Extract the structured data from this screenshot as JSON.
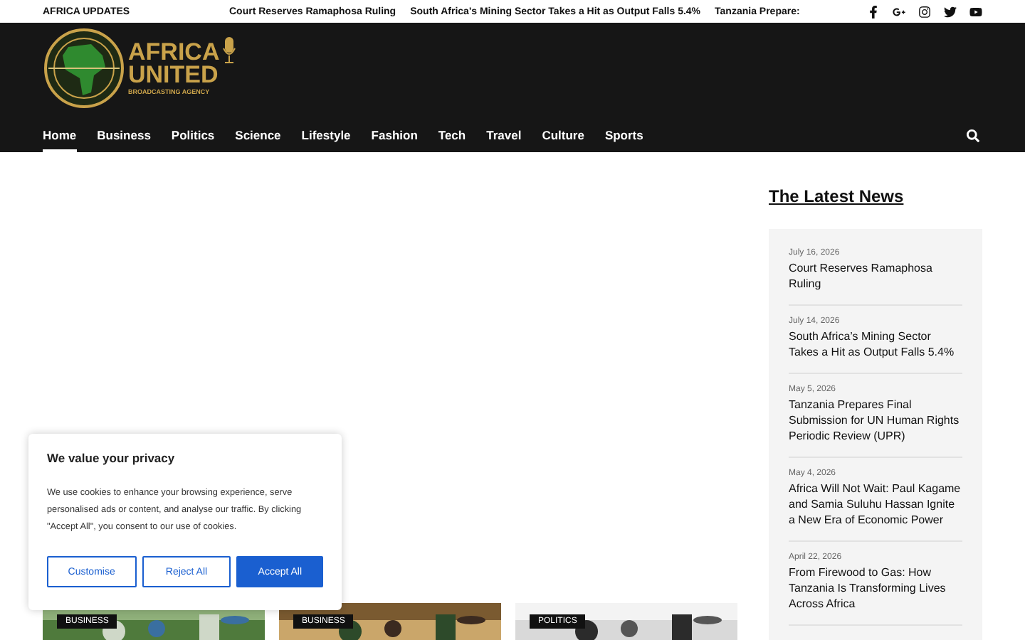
{
  "top_bar": {
    "label": "AFRICA UPDATES",
    "ticker": [
      "Court Reserves Ramaphosa Ruling",
      "South Africa's Mining Sector Takes a Hit as Output Falls 5.4%",
      "Tanzania Prepare:"
    ]
  },
  "logo": {
    "line1": "AFRICA",
    "line2": "UNITED",
    "tagline": "BROADCASTING AGENCY"
  },
  "nav": [
    {
      "label": "Home",
      "selected": true
    },
    {
      "label": "Business",
      "selected": false
    },
    {
      "label": "Politics",
      "selected": false
    },
    {
      "label": "Science",
      "selected": false
    },
    {
      "label": "Lifestyle",
      "selected": false
    },
    {
      "label": "Fashion",
      "selected": false
    },
    {
      "label": "Tech",
      "selected": false
    },
    {
      "label": "Travel",
      "selected": false
    },
    {
      "label": "Culture",
      "selected": false
    },
    {
      "label": "Sports",
      "selected": false
    }
  ],
  "latest_news": {
    "title": "The Latest News",
    "items": [
      {
        "date": "July 16, 2026",
        "headline": "Court Reserves Ramaphosa Ruling"
      },
      {
        "date": "July 14, 2026",
        "headline": "South Africa’s Mining Sector Takes a Hit as Output Falls 5.4%"
      },
      {
        "date": "May 5, 2026",
        "headline": "Tanzania Prepares Final Submission for UN Human Rights Periodic Review (UPR)"
      },
      {
        "date": "May 4, 2026",
        "headline": "Africa Will Not Wait: Paul Kagame and Samia Suluhu Hassan Ignite a New Era of Economic Power"
      },
      {
        "date": "April 22, 2026",
        "headline": "From Firewood to Gas: How Tanzania Is Transforming Lives Across Africa"
      }
    ]
  },
  "cards": [
    {
      "category": "BUSINESS",
      "kind": "picture"
    },
    {
      "category": "BUSINESS",
      "kind": "picture"
    },
    {
      "category": "POLITICS",
      "kind": "picture"
    }
  ],
  "cookie_banner": {
    "title": "We value your privacy",
    "text": "We use cookies to enhance your browsing experience, serve personalised ads or content, and analyse our traffic. By clicking \"Accept All\", you consent to our use of cookies.",
    "buttons": [
      {
        "label": "Customise",
        "kind": "outline"
      },
      {
        "label": "Reject All",
        "kind": "outline"
      },
      {
        "label": "Accept All",
        "kind": "primary"
      }
    ]
  }
}
